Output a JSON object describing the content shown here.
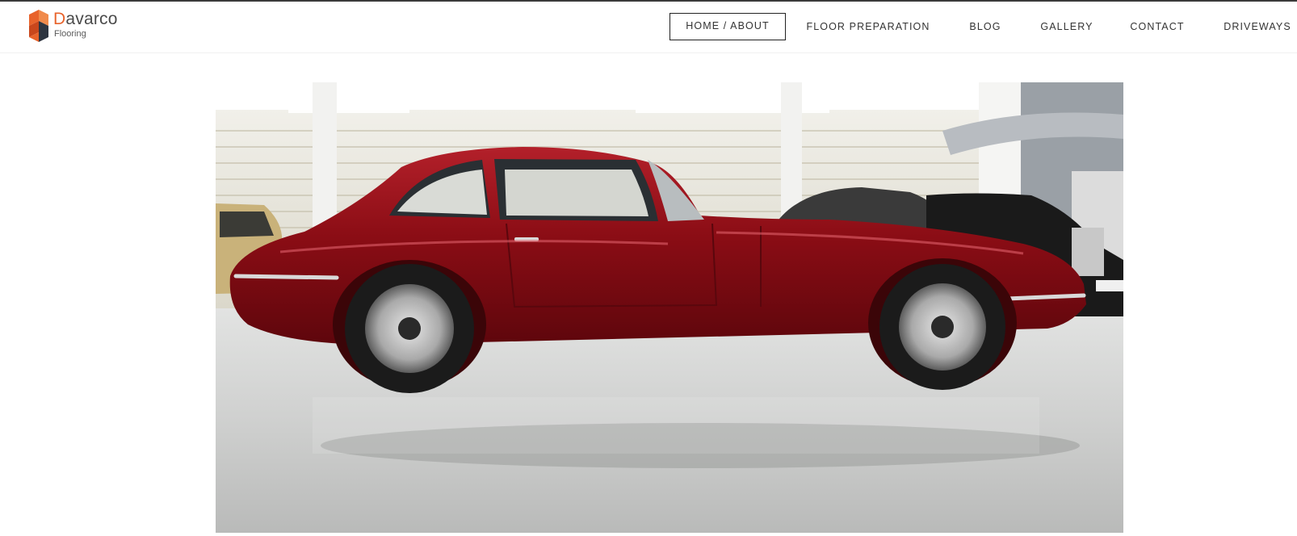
{
  "brand": {
    "name_first": "D",
    "name_rest": "avarco",
    "tagline": "Flooring",
    "accent_color": "#e8632b",
    "logo_icon": "davarco-cube-logo-icon"
  },
  "nav": {
    "items": [
      {
        "label": "HOME / ABOUT",
        "active": true
      },
      {
        "label": "FLOOR PREPARATION",
        "active": false
      },
      {
        "label": "BLOG",
        "active": false
      },
      {
        "label": "GALLERY",
        "active": false
      },
      {
        "label": "CONTACT",
        "active": false
      },
      {
        "label": "DRIVEWAYS",
        "active": false
      }
    ]
  },
  "hero": {
    "image_subject": "Red classic coupe on a polished grey showroom floor",
    "car_color": "#8b0d15",
    "floor_color": "#cfd0cf"
  }
}
